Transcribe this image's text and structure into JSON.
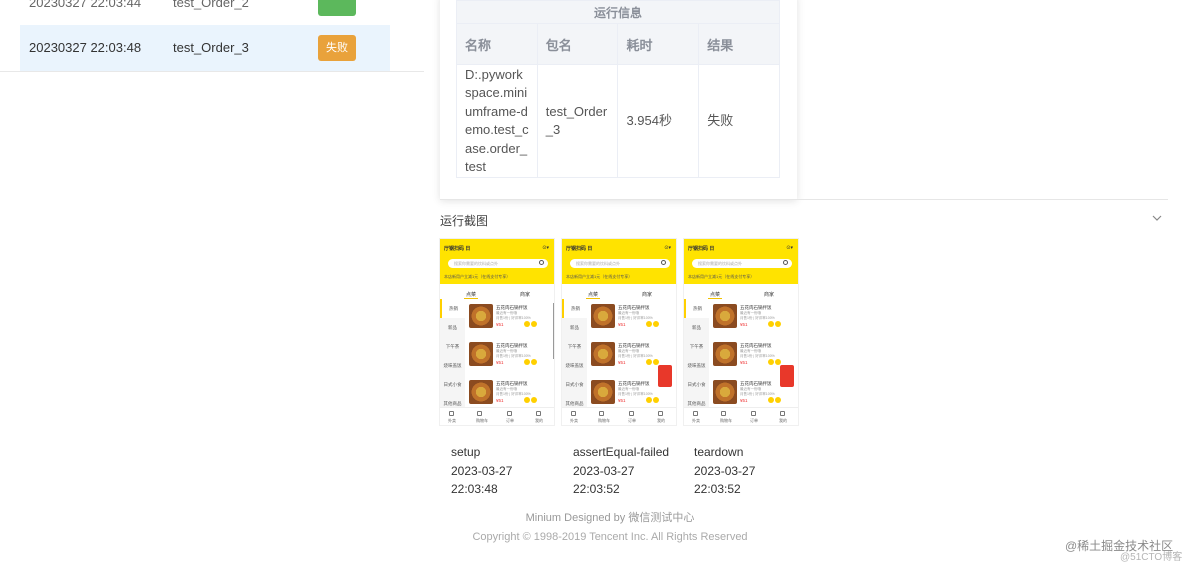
{
  "results": {
    "rows": [
      {
        "datetime": "20230327 22:03:44",
        "name": "test_Order_2",
        "status": ""
      },
      {
        "datetime": "20230327 22:03:48",
        "name": "test_Order_3",
        "status": "失败"
      }
    ]
  },
  "run_info": {
    "title": "运行信息",
    "headers": [
      "名称",
      "包名",
      "耗时",
      "结果"
    ],
    "row": {
      "name": "D:.pyworkspace.miniumframe-demo.test_case.order_test",
      "package": "test_Order_3",
      "duration": "3.954秒",
      "result": "失败"
    }
  },
  "screenshots_section": {
    "title": "运行截图",
    "items": [
      {
        "step": "setup",
        "date": "2023-03-27",
        "time": "22:03:48"
      },
      {
        "step": "assertEqual-failed",
        "date": "2023-03-27",
        "time": "22:03:52"
      },
      {
        "step": "teardown",
        "date": "2023-03-27",
        "time": "22:03:52"
      }
    ]
  },
  "app_preview": {
    "title": "厅钢扫码 日",
    "title_right": "⊙▾",
    "search_placeholder": "搜索你需要的饮料或点外",
    "notice": "本店新用户立减1元（在线支付专享）",
    "tabs": [
      "点菜",
      "商家"
    ],
    "categories": [
      "热销",
      "新品",
      "下午茶",
      "烧味盖饭",
      "日式小食",
      "其他商品"
    ],
    "items": [
      {
        "name": "五花肉石锅拌饭",
        "desc1": "最近有一份哦",
        "desc2": "月售1份 | 好评率100%",
        "price": "¥51"
      },
      {
        "name": "五花肉石锅拌饭",
        "desc1": "最近有一份哦",
        "desc2": "月售1份 | 好评率100%",
        "price": "¥51"
      },
      {
        "name": "五花肉石锅拌饭",
        "desc1": "最近有一份哦",
        "desc2": "月售1份 | 好评率100%",
        "price": "¥51"
      }
    ],
    "nav": [
      "外卖",
      "购物车",
      "订单",
      "我的"
    ]
  },
  "footer": {
    "line1": "Minium Designed by 微信测试中心",
    "line2": "Copyright © 1998-2019 Tencent Inc. All Rights Reserved"
  },
  "watermark": {
    "main": "@稀土掘金技术社区",
    "sub": "@51CTO博客"
  },
  "colors": {
    "fail": "#e9a23b",
    "pass": "#5cb85c",
    "selected_row": "#eaf4fd",
    "app_yellow": "#ffe300"
  }
}
